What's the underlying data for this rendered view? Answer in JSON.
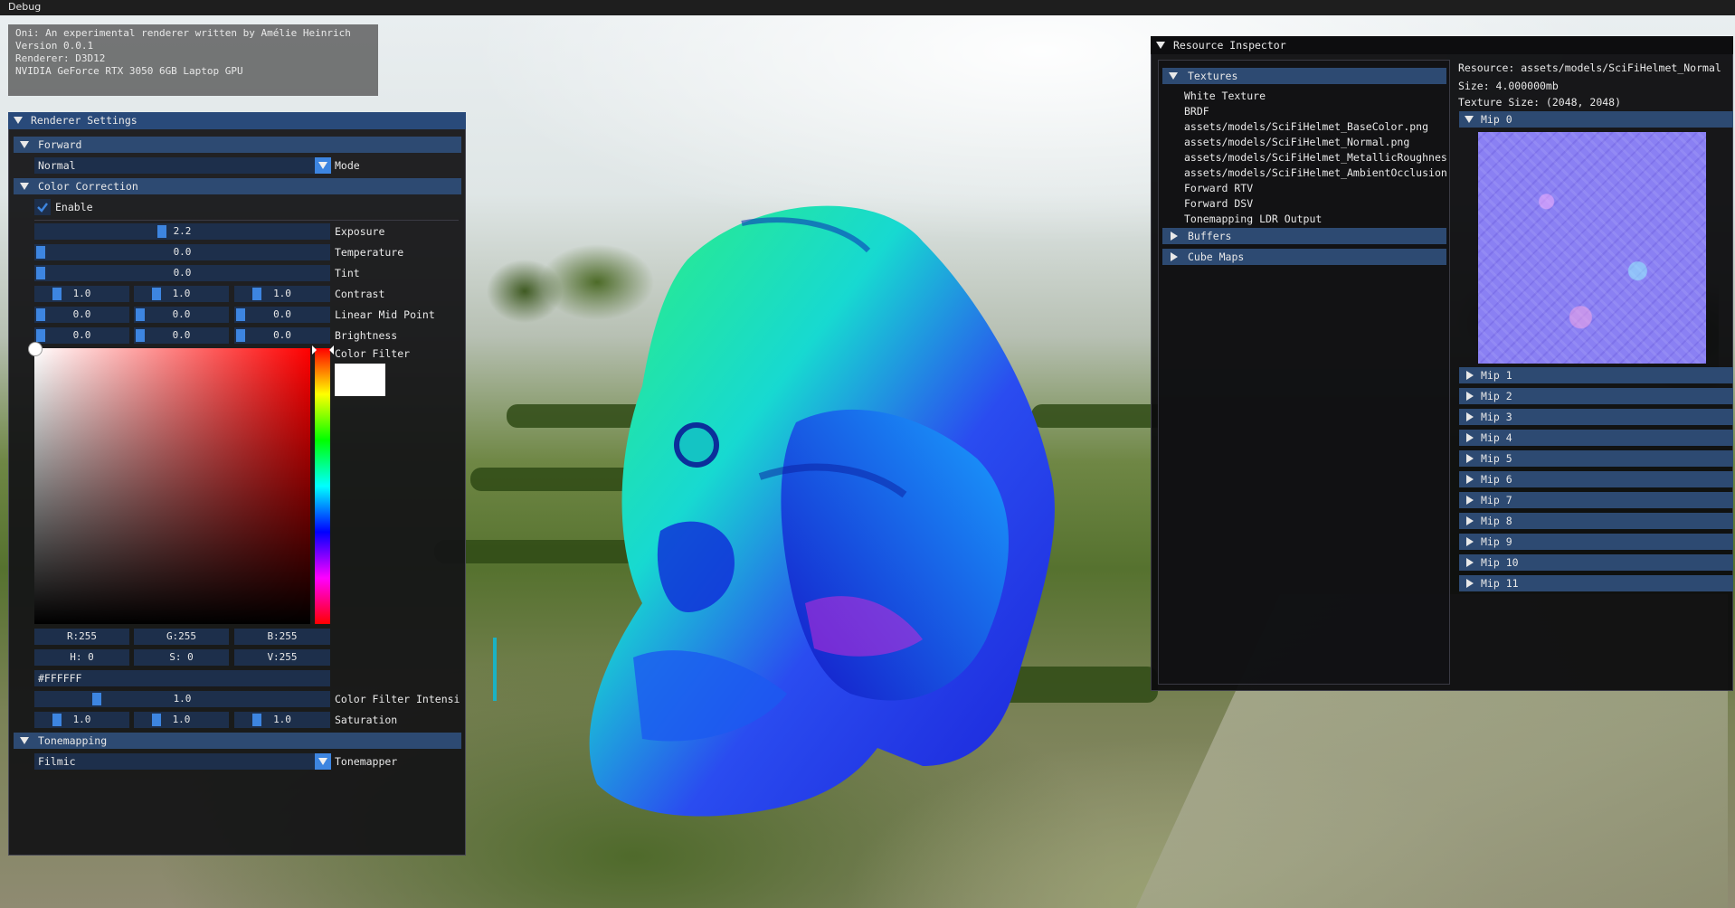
{
  "menu": {
    "debug_label": "Debug"
  },
  "info": {
    "line1": "Oni: An experimental renderer written by Amélie Heinrich",
    "line2": "Version 0.0.1",
    "line3": "Renderer: D3D12",
    "line4": "NVIDIA GeForce RTX 3050 6GB Laptop GPU"
  },
  "renderer_settings": {
    "title": "Renderer Settings",
    "forward_header": "Forward",
    "mode_value": "Normal",
    "mode_label": "Mode",
    "color_correction_header": "Color Correction",
    "enable_label": "Enable",
    "exposure_value": "2.2",
    "exposure_label": "Exposure",
    "temperature_value": "0.0",
    "temperature_label": "Temperature",
    "tint_value": "0.0",
    "tint_label": "Tint",
    "contrast_values": [
      "1.0",
      "1.0",
      "1.0"
    ],
    "contrast_label": "Contrast",
    "midpoint_values": [
      "0.0",
      "0.0",
      "0.0"
    ],
    "midpoint_label": "Linear Mid Point",
    "brightness_values": [
      "0.0",
      "0.0",
      "0.0"
    ],
    "brightness_label": "Brightness",
    "color_filter_label": "Color Filter",
    "rgb": {
      "r": "R:255",
      "g": "G:255",
      "b": "B:255"
    },
    "hsv": {
      "h": "H:  0",
      "s": "S:  0",
      "v": "V:255"
    },
    "hex_value": "#FFFFFF",
    "filter_intensity_value": "1.0",
    "filter_intensity_label": "Color Filter Intensi",
    "saturation_values": [
      "1.0",
      "1.0",
      "1.0"
    ],
    "saturation_label": "Saturation",
    "tonemapping_header": "Tonemapping",
    "tonemapper_value": "Filmic",
    "tonemapper_label": "Tonemapper"
  },
  "resource_inspector": {
    "title": "Resource Inspector",
    "textures_header": "Textures",
    "textures": [
      "White Texture",
      "BRDF",
      "assets/models/SciFiHelmet_BaseColor.png",
      "assets/models/SciFiHelmet_Normal.png",
      "assets/models/SciFiHelmet_MetallicRoughness",
      "assets/models/SciFiHelmet_AmbientOcclusion",
      "Forward RTV",
      "Forward DSV",
      "Tonemapping LDR Output"
    ],
    "buffers_header": "Buffers",
    "cubemaps_header": "Cube Maps",
    "resource_line": "Resource: assets/models/SciFiHelmet_Normal",
    "size_line": "Size: 4.000000mb",
    "texture_size_line": "Texture Size: (2048, 2048)",
    "mips": [
      "Mip 0",
      "Mip 1",
      "Mip 2",
      "Mip 3",
      "Mip 4",
      "Mip 5",
      "Mip 6",
      "Mip 7",
      "Mip 8",
      "Mip 9",
      "Mip 10",
      "Mip 11"
    ]
  },
  "colors": {
    "header_blue": "#2d4a72",
    "title_blue": "#294a7a",
    "accent": "#3d85e0",
    "panel_bg": "#141416"
  }
}
